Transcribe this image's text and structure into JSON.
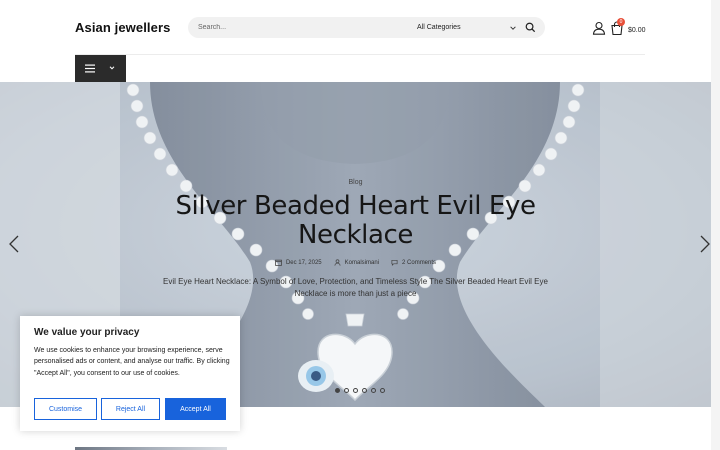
{
  "header": {
    "site_title": "Asian jewellers",
    "search": {
      "placeholder": "Search..."
    },
    "category_select": {
      "selected": "All Categories"
    },
    "cart": {
      "count": "0",
      "total": "$0.00"
    },
    "colors": {
      "badge": "#e8503a",
      "menu_bg": "#2b2b2b"
    },
    "icons": [
      "search-icon",
      "chevron-down-icon",
      "user-icon",
      "cart-icon",
      "hamburger-icon"
    ]
  },
  "hero": {
    "category": "Blog",
    "title": "Silver Beaded Heart Evil Eye Necklace",
    "meta": {
      "date": "Dec 17, 2025",
      "author": "Komalsimani",
      "comments": "2 Comments"
    },
    "excerpt": "Evil Eye Heart Necklace: A Symbol of Love, Protection, and Timeless Style The Silver Beaded Heart Evil Eye Necklace is more than just a piece",
    "slides": {
      "count": 6,
      "active": 1
    },
    "icons": [
      "calendar-icon",
      "author-icon",
      "comment-icon",
      "arrow-left-icon",
      "arrow-right-icon"
    ]
  },
  "cookie_banner": {
    "title": "We value your privacy",
    "text": "We use cookies to enhance your browsing experience, serve personalised ads or content, and analyse our traffic. By clicking \"Accept All\", you consent to our use of cookies.",
    "buttons": {
      "customise": "Customise",
      "reject": "Reject All",
      "accept": "Accept All"
    },
    "colors": {
      "accent": "#1863dc"
    }
  }
}
